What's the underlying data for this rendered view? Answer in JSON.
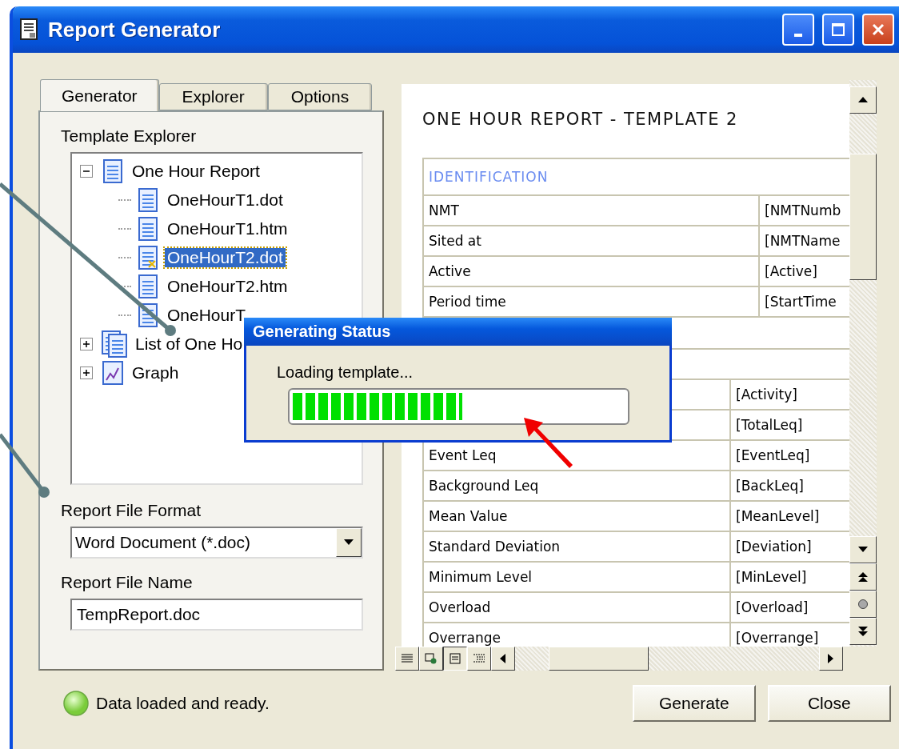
{
  "window": {
    "title": "Report Generator"
  },
  "tabs": [
    {
      "label": "Generator",
      "selected": true
    },
    {
      "label": "Explorer",
      "selected": false
    },
    {
      "label": "Options",
      "selected": false
    }
  ],
  "template_explorer": {
    "label": "Template Explorer",
    "tree": [
      {
        "label": "One Hour Report",
        "kind": "page",
        "expanded": true,
        "selected": false,
        "children": [
          {
            "label": "OneHourT1.dot",
            "kind": "page",
            "selected": false
          },
          {
            "label": "OneHourT1.htm",
            "kind": "page",
            "selected": false
          },
          {
            "label": "OneHourT2.dot",
            "kind": "marked",
            "selected": true
          },
          {
            "label": "OneHourT2.htm",
            "kind": "page",
            "selected": false
          },
          {
            "label": "OneHourT",
            "kind": "page",
            "selected": false
          }
        ]
      },
      {
        "label": "List of One Ho",
        "kind": "stack",
        "expanded": false,
        "selected": false
      },
      {
        "label": "Graph",
        "kind": "graph",
        "expanded": false,
        "selected": false
      }
    ]
  },
  "report_file_format": {
    "label": "Report File Format",
    "value": "Word Document (*.doc)"
  },
  "report_file_name": {
    "label": "Report File Name",
    "value": "TempReport.doc"
  },
  "status": "Data loaded and ready.",
  "preview": {
    "title": "ONE HOUR REPORT - TEMPLATE 2",
    "sections": [
      {
        "heading": "IDENTIFICATION",
        "rows": [
          {
            "label": "NMT",
            "value": "[NMTNumb"
          },
          {
            "label": "Sited at",
            "value": "[NMTName"
          },
          {
            "label": "Active",
            "value": "[Active]"
          },
          {
            "label": "Period time",
            "value": "[StartTime"
          }
        ]
      },
      {
        "rows": [
          {
            "value": "[Activity]"
          },
          {
            "value": "[TotalLeq]"
          },
          {
            "label": "Event Leq",
            "value": "[EventLeq]"
          },
          {
            "label": "Background Leq",
            "value": "[BackLeq]"
          },
          {
            "label": "Mean Value",
            "value": "[MeanLevel]"
          },
          {
            "label": "Standard Deviation",
            "value": "[Deviation]"
          },
          {
            "label": "Minimum Level",
            "value": "[MinLevel]"
          },
          {
            "label": "Overload",
            "value": "[Overload]"
          },
          {
            "label": "Overrange",
            "value": "[Overrange]"
          }
        ]
      }
    ]
  },
  "buttons": [
    "Generate",
    "Close"
  ],
  "dialog": {
    "title": "Generating Status",
    "message": "Loading template...",
    "level": 0.51
  }
}
